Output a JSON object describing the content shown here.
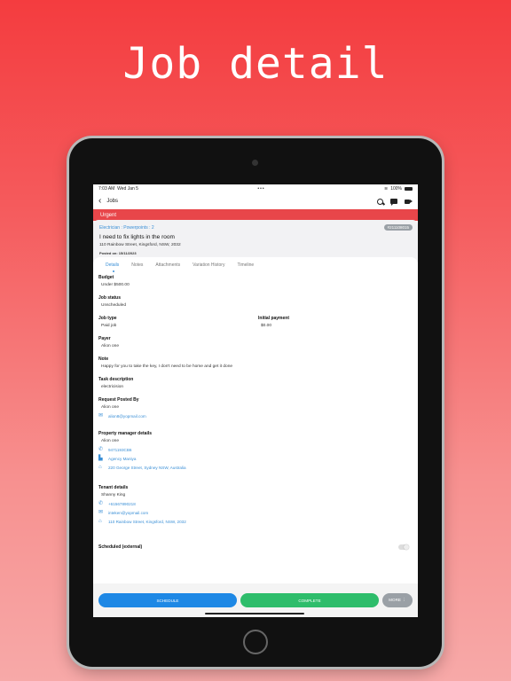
{
  "headline": "Job detail",
  "status_bar": {
    "time": "7:03 AM",
    "date": "Wed Jan 5",
    "dots": "•••",
    "battery": "100%"
  },
  "nav": {
    "back_label": "Jobs"
  },
  "urgent_label": "Urgent",
  "job": {
    "category": "Electrician : Powerpoints : 2",
    "id": "#211108015",
    "title": "I need to fix lights in the room",
    "address": "110 Rainbow Street, Kingsford, NSW, 2032",
    "posted": "Posted on: 15/11/2023"
  },
  "tabs": [
    "Details",
    "Notes",
    "Attachments",
    "Variation History",
    "Timeline"
  ],
  "details": {
    "budget_label": "Budget",
    "budget_value": "Under $500.00",
    "job_status_label": "Job status",
    "job_status_value": "Unscheduled",
    "job_type_label": "Job type",
    "job_type_value": "Paid job",
    "initial_payment_label": "Initial payment",
    "initial_payment_value": "$0.00",
    "payer_label": "Payer",
    "payer_value": "Alion one",
    "note_label": "Note",
    "note_value": "Happy for you to take the key, I don't need to be home and get it done",
    "task_label": "Task description",
    "task_value": "electricision",
    "request_label": "Request Posted By",
    "request_name": "Alion one",
    "request_email": "alion8@yopmail.com",
    "pm_label": "Property manager details",
    "pm_name": "Alion one",
    "pm_phone": "9471193CB6",
    "pm_agency": "Agency Maniya",
    "pm_address": "220 George Street, Sydney NSW, Australia",
    "tenant_label": "Tenant details",
    "tenant_name": "Shanny King",
    "tenant_phone": "+61567890218",
    "tenant_email": "inteken@yopmail.com",
    "tenant_address": "110 Rainbow Street, Kingsford, NSW, 2032",
    "scheduled_label": "Scheduled (external)"
  },
  "actions": {
    "schedule": "SCHEDULE",
    "complete": "COMPLETE",
    "more": "MORE ⋮"
  }
}
